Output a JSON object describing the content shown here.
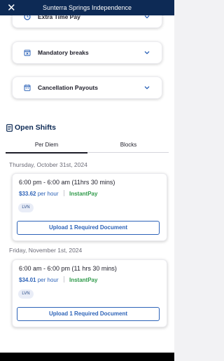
{
  "topbar": {
    "title": "Sunterra Springs Independence",
    "close_symbol": "✕"
  },
  "accordions": [
    {
      "label": "Extra Time Pay",
      "icon": "clock-icon"
    },
    {
      "label": "Mandatory breaks",
      "icon": "calendar-x-icon"
    },
    {
      "label": "Cancellation Payouts",
      "icon": "calendar-icon"
    }
  ],
  "open_shifts": {
    "title": "Open Shifts",
    "icon": "document-icon",
    "tabs": [
      {
        "label": "Per Diem",
        "active": true
      },
      {
        "label": "Blocks",
        "active": false
      }
    ]
  },
  "shifts": [
    {
      "date": "Thursday, October 31st, 2024",
      "time": "6:00 pm - 6:00 am (11hrs 30 mins)",
      "rate": "$33.62",
      "per": "per hour",
      "instant": "InstantPay",
      "badge": "LVN",
      "button": "Upload 1 Required Document"
    },
    {
      "date": "Friday, November 1st, 2024",
      "time": "6:00 am - 6:00 pm (11 hrs 30 mins)",
      "rate": "$34.01",
      "per": "per hour",
      "instant": "InstantPay",
      "badge": "LVN",
      "button": "Upload 1 Required Document"
    }
  ],
  "colors": {
    "navy": "#0d2a55",
    "blue": "#2d63b8",
    "green": "#2f9a4a"
  }
}
